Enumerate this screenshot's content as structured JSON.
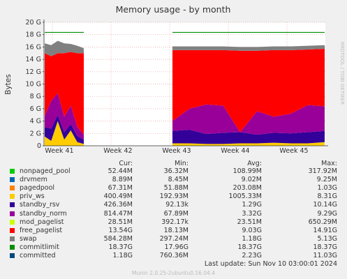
{
  "chart_data": {
    "type": "area",
    "title": "Memory usage - by month",
    "ylabel": "Bytes",
    "ylim": [
      0,
      20
    ],
    "yunit": "G",
    "yticks": [
      "0",
      "2 G",
      "4 G",
      "6 G",
      "8 G",
      "10 G",
      "12 G",
      "14 G",
      "16 G",
      "18 G",
      "20 G"
    ],
    "xlabels": [
      "Week 41",
      "Week 42",
      "Week 43",
      "Week 44",
      "Week 45"
    ],
    "side_label": "RRDTOOL / TOBI OETIKER",
    "commitlimit_value": 18.37,
    "series": [
      {
        "name": "nonpaged_pool",
        "color": "#00cc00"
      },
      {
        "name": "drvmem",
        "color": "#0066b3"
      },
      {
        "name": "pagedpool",
        "color": "#ff8000"
      },
      {
        "name": "priv_ws",
        "color": "#ffcc00"
      },
      {
        "name": "standby_rsv",
        "color": "#330099"
      },
      {
        "name": "standby_norm",
        "color": "#990099"
      },
      {
        "name": "mod_pagelist",
        "color": "#ccff00"
      },
      {
        "name": "free_pagelist",
        "color": "#ff0000"
      },
      {
        "name": "swap",
        "color": "#808080"
      },
      {
        "name": "commitlimit",
        "color": "#008f00"
      },
      {
        "name": "committed",
        "color": "#00487d"
      }
    ],
    "stack_segments": [
      {
        "x_start": "Week 41 start",
        "x_end": "Week 41 end",
        "points": [
          {
            "priv_ws": 1.5,
            "standby_rsv": 1.5,
            "standby_norm": 1.8,
            "free_pagelist": 10.2,
            "swap": 1.6
          },
          {
            "priv_ws": 0.8,
            "standby_rsv": 2.0,
            "standby_norm": 4.5,
            "free_pagelist": 7.2,
            "swap": 1.8
          },
          {
            "priv_ws": 4.0,
            "standby_rsv": 1.0,
            "standby_norm": 3.5,
            "free_pagelist": 6.5,
            "swap": 2.0
          },
          {
            "priv_ws": 1.0,
            "standby_rsv": 1.2,
            "standby_norm": 2.5,
            "free_pagelist": 10.3,
            "swap": 1.6
          },
          {
            "priv_ws": 2.5,
            "standby_rsv": 1.0,
            "standby_norm": 3.0,
            "free_pagelist": 8.7,
            "swap": 1.3
          },
          {
            "priv_ws": 0.6,
            "standby_rsv": 1.0,
            "standby_norm": 1.5,
            "free_pagelist": 11.9,
            "swap": 1.2
          },
          {
            "priv_ws": 0.3,
            "standby_rsv": 0.7,
            "standby_norm": 0.8,
            "free_pagelist": 13.2,
            "swap": 0.8
          }
        ]
      },
      {
        "x_start": "Week 43 start",
        "x_end": "Week 45 end",
        "points": [
          {
            "priv_ws": 0.4,
            "standby_rsv": 2.0,
            "standby_norm": 1.6,
            "free_pagelist": 11.5,
            "swap": 0.6
          },
          {
            "priv_ws": 0.4,
            "standby_rsv": 2.2,
            "standby_norm": 3.4,
            "free_pagelist": 9.5,
            "swap": 0.6
          },
          {
            "priv_ws": 0.3,
            "standby_rsv": 1.6,
            "standby_norm": 4.8,
            "free_pagelist": 8.8,
            "swap": 0.6
          },
          {
            "priv_ws": 0.3,
            "standby_rsv": 1.8,
            "standby_norm": 4.4,
            "free_pagelist": 9.0,
            "swap": 0.6
          },
          {
            "priv_ws": 0.4,
            "standby_rsv": 1.8,
            "standby_norm": 0.0,
            "free_pagelist": 13.2,
            "swap": 0.6
          },
          {
            "priv_ws": 0.4,
            "standby_rsv": 1.4,
            "standby_norm": 3.8,
            "free_pagelist": 9.8,
            "swap": 0.6
          },
          {
            "priv_ws": 0.5,
            "standby_rsv": 1.6,
            "standby_norm": 2.6,
            "free_pagelist": 10.8,
            "swap": 0.6
          },
          {
            "priv_ws": 0.4,
            "standby_rsv": 1.6,
            "standby_norm": 3.2,
            "free_pagelist": 10.3,
            "swap": 0.6
          },
          {
            "priv_ws": 0.4,
            "standby_rsv": 1.8,
            "standby_norm": 4.4,
            "free_pagelist": 9.0,
            "swap": 0.6
          },
          {
            "priv_ws": 0.6,
            "standby_rsv": 1.8,
            "standby_norm": 4.0,
            "free_pagelist": 9.3,
            "swap": 0.6
          }
        ]
      }
    ]
  },
  "legend_headers": {
    "cur": "Cur:",
    "min": "Min:",
    "avg": "Avg:",
    "max": "Max:"
  },
  "legend": [
    {
      "name": "nonpaged_pool",
      "color": "#00cc00",
      "cur": "52.44M",
      "min": "36.32M",
      "avg": "108.99M",
      "max": "317.92M"
    },
    {
      "name": "drvmem",
      "color": "#0066b3",
      "cur": "8.89M",
      "min": "8.45M",
      "avg": "9.02M",
      "max": "9.25M"
    },
    {
      "name": "pagedpool",
      "color": "#ff8000",
      "cur": "67.31M",
      "min": "51.88M",
      "avg": "203.08M",
      "max": "1.03G"
    },
    {
      "name": "priv_ws",
      "color": "#ffcc00",
      "cur": "400.49M",
      "min": "192.93M",
      "avg": "1005.33M",
      "max": "8.31G"
    },
    {
      "name": "standby_rsv",
      "color": "#330099",
      "cur": "426.36M",
      "min": "92.13k",
      "avg": "1.29G",
      "max": "10.14G"
    },
    {
      "name": "standby_norm",
      "color": "#990099",
      "cur": "814.47M",
      "min": "67.89M",
      "avg": "3.32G",
      "max": "9.29G"
    },
    {
      "name": "mod_pagelist",
      "color": "#ccff00",
      "cur": "28.51M",
      "min": "392.17k",
      "avg": "23.51M",
      "max": "650.29M"
    },
    {
      "name": "free_pagelist",
      "color": "#ff0000",
      "cur": "13.54G",
      "min": "18.13M",
      "avg": "9.03G",
      "max": "14.91G"
    },
    {
      "name": "swap",
      "color": "#808080",
      "cur": "584.28M",
      "min": "297.24M",
      "avg": "1.18G",
      "max": "5.13G"
    },
    {
      "name": "commitlimit",
      "color": "#008f00",
      "cur": "18.37G",
      "min": "17.96G",
      "avg": "18.37G",
      "max": "18.37G"
    },
    {
      "name": "committed",
      "color": "#00487d",
      "cur": "1.18G",
      "min": "760.36M",
      "avg": "2.23G",
      "max": "11.03G"
    }
  ],
  "last_update": "Last update:  Sun Nov 10 03:00:01 2024",
  "footer": "Munin 2.0.25-2ubuntu0.16.04.4"
}
